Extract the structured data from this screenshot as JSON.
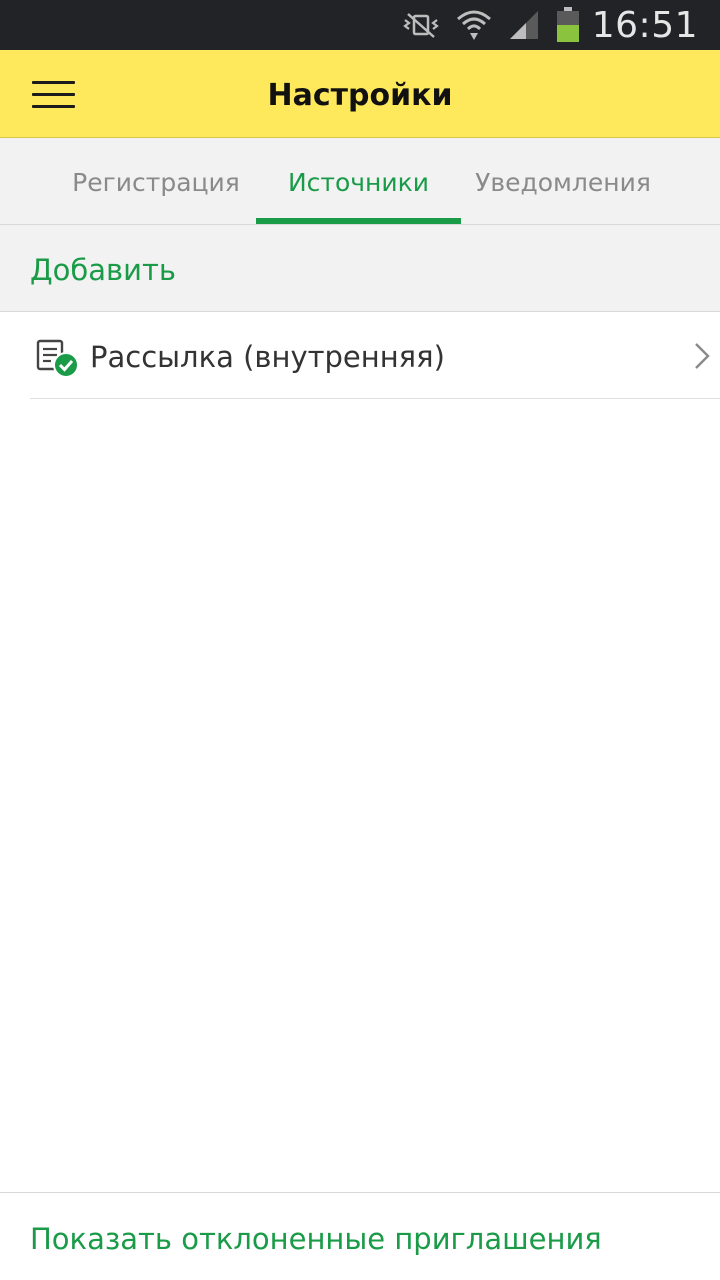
{
  "status_bar": {
    "time": "16:51",
    "icons": [
      "vibrate-mute-icon",
      "wifi-icon",
      "signal-icon",
      "battery-icon"
    ]
  },
  "app_bar": {
    "menu_icon": "hamburger-menu-icon",
    "title": "Настройки"
  },
  "tabs": {
    "items": [
      {
        "label": "Регистрация",
        "active": false
      },
      {
        "label": "Источники",
        "active": true
      },
      {
        "label": "Уведомления",
        "active": false
      }
    ]
  },
  "add_action": {
    "label": "Добавить"
  },
  "sources": {
    "items": [
      {
        "label": "Рассылка (внутренняя)",
        "icon": "document-check-icon"
      }
    ]
  },
  "footer": {
    "label": "Показать отклоненные приглашения"
  },
  "colors": {
    "accent": "#1a9b48",
    "app_bar": "#fde95b",
    "status_bar": "#222326",
    "tab_bg": "#f2f2f2",
    "inactive_tab_text": "#8a8a8a",
    "battery_fill": "#8ac43f"
  }
}
